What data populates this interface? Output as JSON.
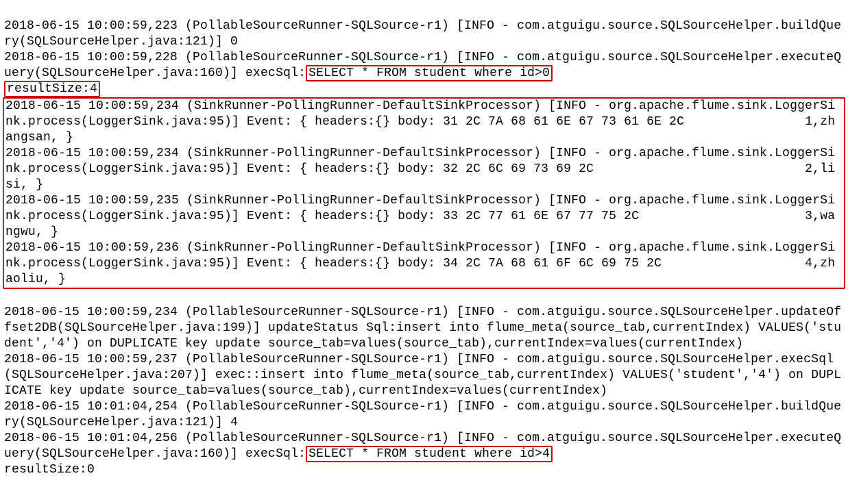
{
  "lines": {
    "l1": "2018-06-15 10:00:59,223 (PollableSourceRunner-SQLSource-r1) [INFO - com.atguigu.source.SQLSourceHelper.buildQuery(SQLSourceHelper.java:121)] 0",
    "l2a": "2018-06-15 10:00:59,228 (PollableSourceRunner-SQLSource-r1) [INFO - com.atguigu.source.SQLSourceHelper.executeQuery(SQLSourceHelper.java:160)] execSql:",
    "l2b": "SELECT * FROM student where id>0",
    "l3": "resultSize:4",
    "e1": "2018-06-15 10:00:59,234 (SinkRunner-PollingRunner-DefaultSinkProcessor) [INFO - org.apache.flume.sink.LoggerSink.process(LoggerSink.java:95)] Event: { headers:{} body: 31 2C 7A 68 61 6E 67 73 61 6E 2C                1,zhangsan, }",
    "e2": "2018-06-15 10:00:59,234 (SinkRunner-PollingRunner-DefaultSinkProcessor) [INFO - org.apache.flume.sink.LoggerSink.process(LoggerSink.java:95)] Event: { headers:{} body: 32 2C 6C 69 73 69 2C                            2,lisi, }",
    "e3": "2018-06-15 10:00:59,235 (SinkRunner-PollingRunner-DefaultSinkProcessor) [INFO - org.apache.flume.sink.LoggerSink.process(LoggerSink.java:95)] Event: { headers:{} body: 33 2C 77 61 6E 67 77 75 2C                      3,wangwu, }",
    "e4": "2018-06-15 10:00:59,236 (SinkRunner-PollingRunner-DefaultSinkProcessor) [INFO - org.apache.flume.sink.LoggerSink.process(LoggerSink.java:95)] Event: { headers:{} body: 34 2C 7A 68 61 6F 6C 69 75 2C                   4,zhaoliu, }",
    "l4": "2018-06-15 10:00:59,234 (PollableSourceRunner-SQLSource-r1) [INFO - com.atguigu.source.SQLSourceHelper.updateOffset2DB(SQLSourceHelper.java:199)] updateStatus Sql:insert into flume_meta(source_tab,currentIndex) VALUES('student','4') on DUPLICATE key update source_tab=values(source_tab),currentIndex=values(currentIndex)",
    "l5": "2018-06-15 10:00:59,237 (PollableSourceRunner-SQLSource-r1) [INFO - com.atguigu.source.SQLSourceHelper.execSql(SQLSourceHelper.java:207)] exec::insert into flume_meta(source_tab,currentIndex) VALUES('student','4') on DUPLICATE key update source_tab=values(source_tab),currentIndex=values(currentIndex)",
    "l6": "2018-06-15 10:01:04,254 (PollableSourceRunner-SQLSource-r1) [INFO - com.atguigu.source.SQLSourceHelper.buildQuery(SQLSourceHelper.java:121)] 4",
    "l7a": "2018-06-15 10:01:04,256 (PollableSourceRunner-SQLSource-r1) [INFO - com.atguigu.source.SQLSourceHelper.executeQuery(SQLSourceHelper.java:160)] execSql:",
    "l7b": "SELECT * FROM student where id>4",
    "l8": "resultSize:0"
  }
}
